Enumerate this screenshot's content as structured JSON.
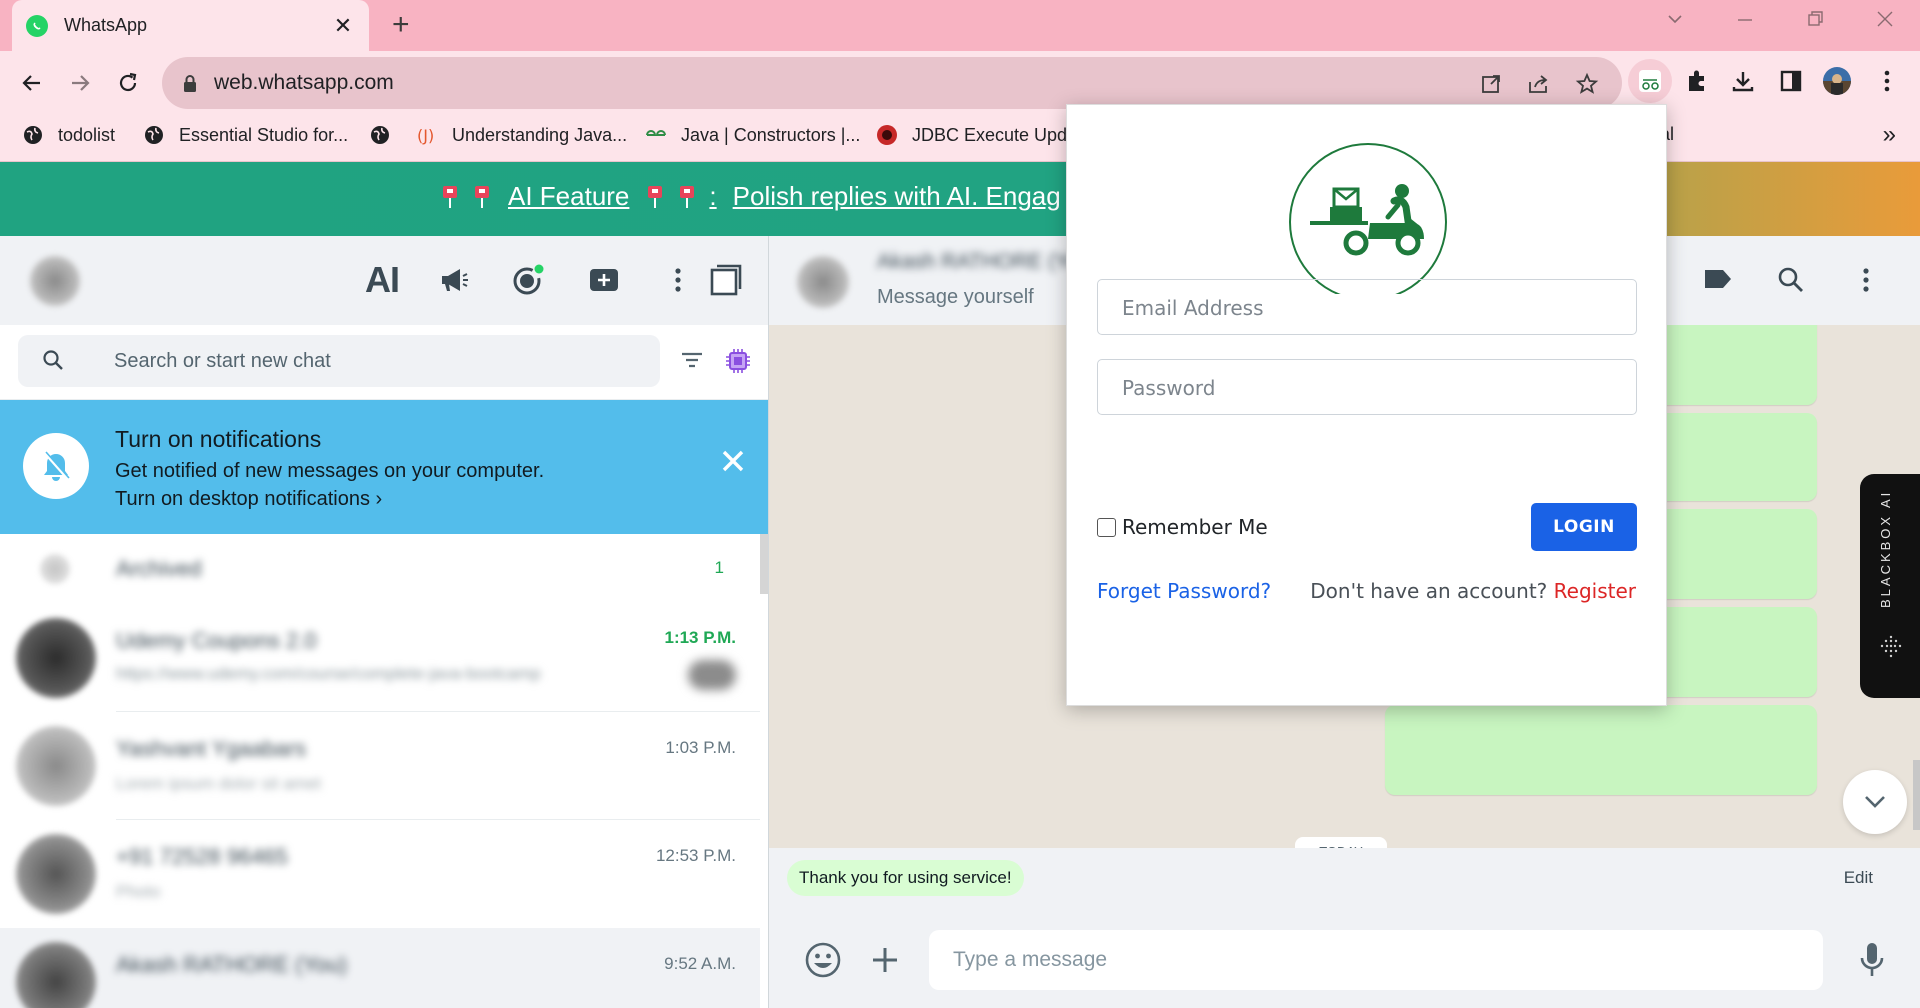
{
  "browser": {
    "tab_title": "WhatsApp",
    "tab_close": "✕",
    "new_tab": "+",
    "url": "web.whatsapp.com",
    "bookmarks": [
      {
        "label": "todolist",
        "icon": "globe-icon"
      },
      {
        "label": "Essential Studio for...",
        "icon": "globe-icon"
      },
      {
        "label": "",
        "icon": "globe-icon"
      },
      {
        "label": "Understanding Java...",
        "icon": "j-logo-icon"
      },
      {
        "label": "Java | Constructors |...",
        "icon": "gfg-logo-icon"
      },
      {
        "label": "JDBC Execute Upda",
        "icon": "red-logo-icon"
      },
      {
        "label": "al",
        "icon": ""
      }
    ],
    "bookmarks_more": "»"
  },
  "banner": {
    "feature": "AI Feature",
    "colon": ":",
    "text": "Polish replies with AI. Engag"
  },
  "left_pane": {
    "ai_label": "AI",
    "search_placeholder": "Search or start new chat",
    "notification": {
      "title": "Turn on notifications",
      "subtitle": "Get notified of new messages on your computer.",
      "link": "Turn on desktop notifications ›"
    },
    "archived": {
      "label": "Archived",
      "count": "1"
    },
    "chats": [
      {
        "name": "Udemy Coupons 2.0",
        "preview": "https://www.udemy.com/course/complete-java-bootcamp",
        "time": "1:13 P.M.",
        "unread": true
      },
      {
        "name": "Yashvant Ygaabars",
        "preview": "Lorem ipsum dolor sit amet",
        "time": "1:03 P.M.",
        "unread": false
      },
      {
        "name": "+91 72528 96465",
        "preview": "Photo",
        "time": "12:53 P.M.",
        "unread": false
      },
      {
        "name": "Akash RATHORE (You)",
        "preview": "",
        "time": "9:52 A.M.",
        "unread": false
      }
    ]
  },
  "right_pane": {
    "contact_name": "Akash RATHORE (You)",
    "contact_sub": "Message yourself",
    "today_label": "TODAY",
    "suggestion": "Thank you for using service!",
    "edit_label": "Edit",
    "message_placeholder": "Type a message"
  },
  "blackbox": {
    "label": "BLACKBOX AI"
  },
  "popup": {
    "email_placeholder": "Email Address",
    "password_placeholder": "Password",
    "remember_label": "Remember Me",
    "login_label": "LOGIN",
    "forget_label": "Forget Password?",
    "no_account": "Don't have an account?",
    "register_label": "Register"
  },
  "colors": {
    "tabstrip": "#f8b3c2",
    "toolbar": "#fde4ea",
    "banner": "#20a381",
    "notification": "#53bdeb",
    "whatsapp_green": "#1fa855",
    "login_blue": "#1a62e6",
    "register_red": "#dc2626"
  }
}
